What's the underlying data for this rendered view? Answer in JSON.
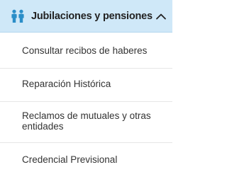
{
  "menu": {
    "header": {
      "icon": "people-icon",
      "label": "Jubilaciones y pensiones",
      "chevron": "chevron-up-icon",
      "expanded": true
    },
    "items": [
      {
        "label": "Consultar recibos de haberes"
      },
      {
        "label": "Reparación Histórica"
      },
      {
        "label": "Reclamos de mutuales y otras entidades"
      },
      {
        "label": "Credencial Previsional"
      }
    ]
  },
  "colors": {
    "header_background": "#cfe8f8",
    "accent": "#2a8ec8",
    "text": "#333333"
  }
}
